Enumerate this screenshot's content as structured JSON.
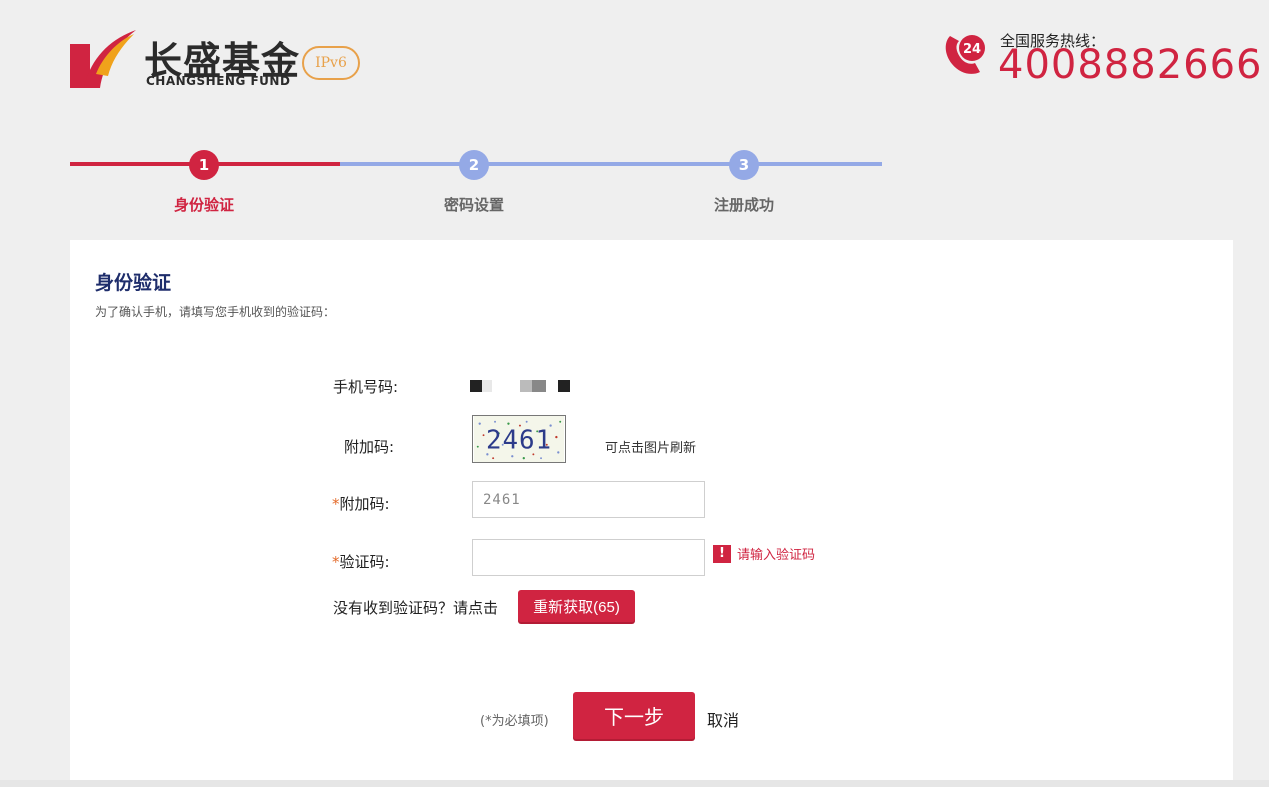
{
  "header": {
    "logo_cn": "长盛基金",
    "logo_en": "CHANGSHENG FUND",
    "logo_badge": "IPv6",
    "hotline_label": "全国服务热线：",
    "hotline_number": "4008882666",
    "hotline_badge": "24"
  },
  "steps": [
    {
      "num": "1",
      "label": "身份验证",
      "active": true
    },
    {
      "num": "2",
      "label": "密码设置",
      "active": false
    },
    {
      "num": "3",
      "label": "注册成功",
      "active": false
    }
  ],
  "colors": {
    "brand_red": "#d02441",
    "step_inactive": "#94a9e6",
    "title_navy": "#1e2d6b"
  },
  "form": {
    "title": "身份验证",
    "subtitle": "为了确认手机，请填写您手机收到的验证码：",
    "phone_label": "手机号码:",
    "captcha_label": "附加码:",
    "captcha_text": "2461",
    "captcha_tip": "可点击图片刷新",
    "captcha_input_req": "*",
    "captcha_input_label": "附加码:",
    "captcha_input_value": "2461",
    "sms_req": "*",
    "sms_label": "验证码:",
    "sms_value": "",
    "sms_error": "请输入验证码",
    "error_icon": "!",
    "no_receive": "没有收到验证码？请点击",
    "resend_label": "重新获取(65)",
    "required_note": "(*为必填项)",
    "next_label": "下一步",
    "cancel_label": "取消"
  }
}
